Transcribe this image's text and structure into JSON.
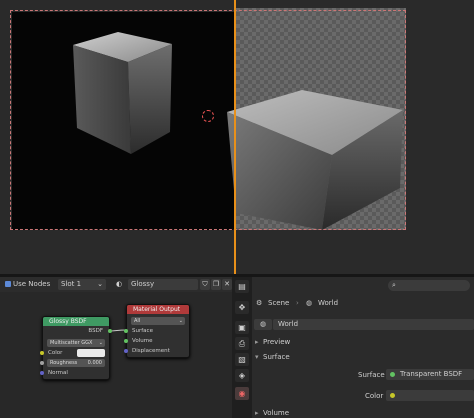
{
  "node_header": {
    "use_nodes_label": "Use Nodes",
    "slot_label": "Slot 1",
    "material_name": "Glossy"
  },
  "nodes": {
    "glossy": {
      "title": "Glossy BSDF",
      "output_label": "BSDF",
      "distribution": "Multiscatter GGX",
      "color_label": "Color",
      "roughness_label": "Roughness",
      "roughness_value": "0.000",
      "normal_label": "Normal"
    },
    "material_output": {
      "title": "Material Output",
      "target": "All",
      "surface_label": "Surface",
      "volume_label": "Volume",
      "displacement_label": "Displacement"
    }
  },
  "properties": {
    "breadcrumb_scene": "Scene",
    "breadcrumb_world": "World",
    "world_name": "World",
    "preview_label": "Preview",
    "surface_panel_label": "Surface",
    "surface_field_label": "Surface",
    "surface_value": "Transparent BSDF",
    "color_label": "Color",
    "volume_label": "Volume"
  },
  "colors": {
    "accent_orange": "#e8901a",
    "glossy_header": "#3f9a63",
    "output_header": "#b03a3a",
    "socket_green": "#62c262",
    "socket_yellow": "#c7c729",
    "socket_blue": "#6363c7"
  }
}
